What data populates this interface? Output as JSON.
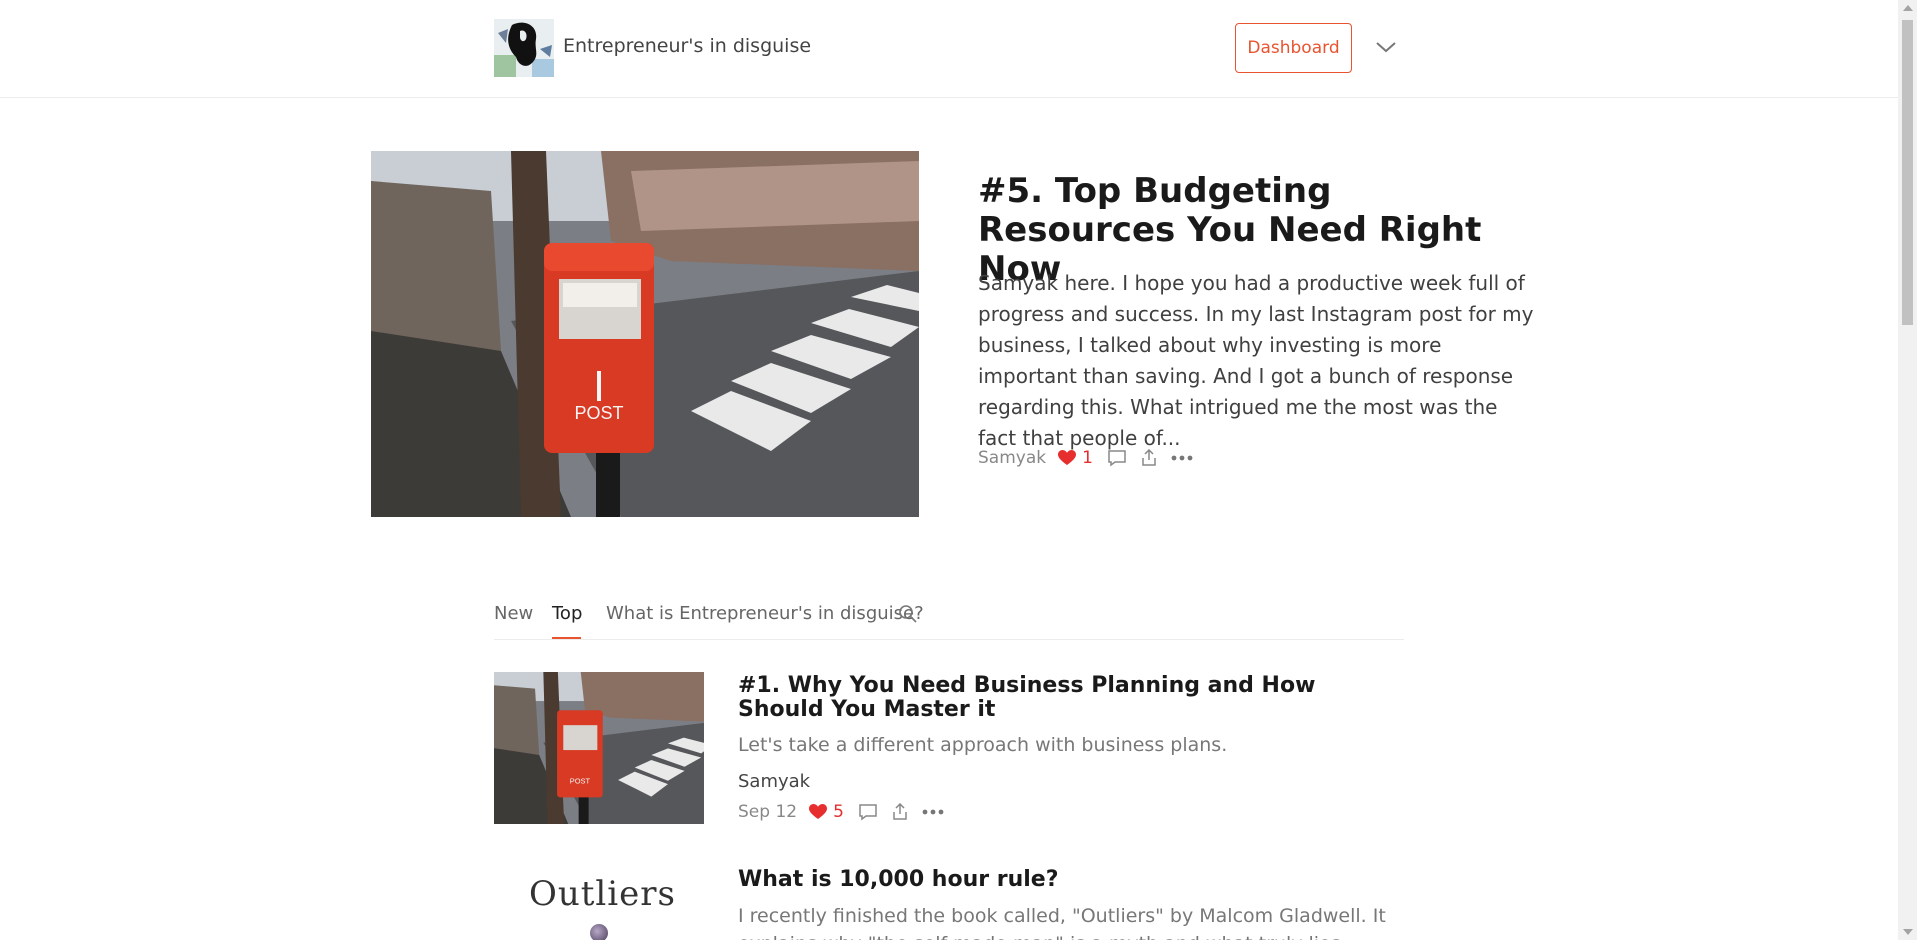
{
  "header": {
    "site_title": "Entrepreneur's in disguise",
    "dashboard_label": "Dashboard",
    "accent_color": "#e8542f"
  },
  "hero": {
    "title": "#5. Top Budgeting Resources You Need Right Now",
    "excerpt": "Samyak here. I hope you had a productive week full of progress and success. In my last Instagram post for my business, I talked about why investing is more important than saving. And I got a bunch of response regarding this. What intrigued me the most was the fact that people of...",
    "author": "Samyak",
    "likes": "1",
    "image_desc": "red-post-box-photo"
  },
  "tabs": [
    {
      "label": "New"
    },
    {
      "label": "Top"
    },
    {
      "label": "What is Entrepreneur's in disguise?"
    }
  ],
  "posts": [
    {
      "title": "#1. Why You Need Business Planning and How Should You Master it",
      "subtitle": "Let's take a different approach with business plans.",
      "author": "Samyak",
      "date": "Sep 12",
      "likes": "5"
    },
    {
      "title": "What is 10,000 hour rule?",
      "subtitle": "I recently finished the book called, \"Outliers\" by Malcom Gladwell. It explains why \"the self-made man\" is a myth and what truly lies behind the",
      "thumb_text": "Outliers"
    }
  ],
  "icons": {
    "heart": "heart-icon",
    "comment": "comment-icon",
    "share": "share-icon",
    "more": "more-icon",
    "search": "search-icon",
    "chevron": "chevron-down-icon"
  }
}
